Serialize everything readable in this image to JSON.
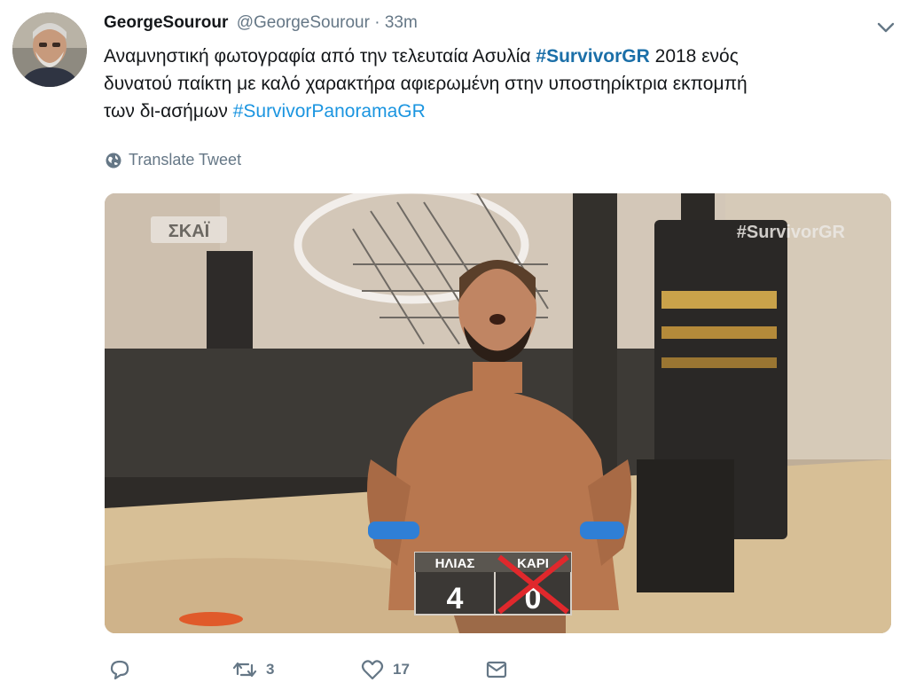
{
  "tweet": {
    "display_name": "GeorgeSourour",
    "handle": "@GeorgeSourour",
    "separator": "·",
    "time": "33m",
    "text_line1_pre": "Αναμνηστική φωτογραφία από την τελευταία Ασυλία",
    "hashtag1": "#SurvivorGR",
    "text_line1_post": "2018 ενός",
    "text_line2": "δυνατού παίκτη με καλό χαρακτήρα αφιερωμένη στην υποστηρίκτρια εκπομπή",
    "text_line3_pre": "των δι-ασήμων",
    "hashtag2": "#SurvivorPanoramaGR",
    "translate_label": "Translate Tweet",
    "retweet_count": "3",
    "like_count": "17"
  },
  "media": {
    "channel_logo": "ΣΚΑΪ",
    "watermark": "#SurvivorGR",
    "score_left_name": "ΗΛΙΑΣ",
    "score_left_value": "4",
    "score_right_name": "ΚΑΡΙ",
    "score_right_value": "0"
  },
  "icons": {
    "caret": "chevron-down-icon",
    "translate": "globe-icon",
    "reply": "reply-icon",
    "retweet": "retweet-icon",
    "like": "heart-icon",
    "dm": "envelope-icon"
  },
  "colors": {
    "hashtag": "#1b95e0",
    "muted": "#657786",
    "text": "#14171a"
  }
}
